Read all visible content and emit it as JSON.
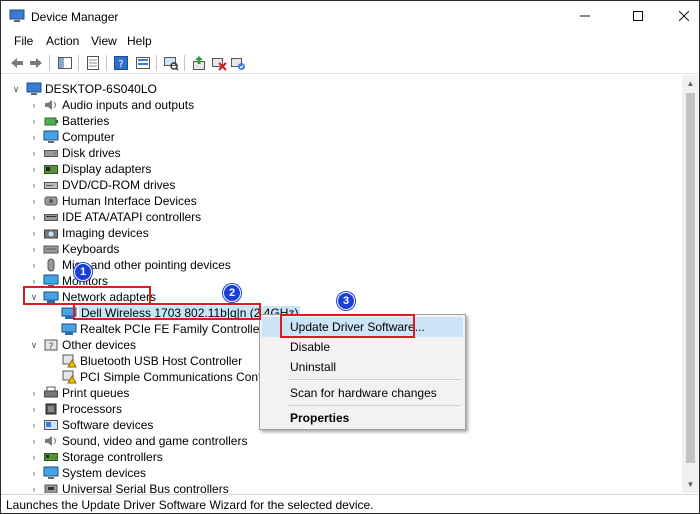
{
  "window": {
    "title": "Device Manager"
  },
  "menu": [
    "File",
    "Action",
    "View",
    "Help"
  ],
  "tree": {
    "root": "DESKTOP-6S040LO",
    "items": [
      "Audio inputs and outputs",
      "Batteries",
      "Computer",
      "Disk drives",
      "Display adapters",
      "DVD/CD-ROM drives",
      "Human Interface Devices",
      "IDE ATA/ATAPI controllers",
      "Imaging devices",
      "Keyboards",
      "Mice and other pointing devices",
      "Monitors",
      "Network adapters",
      "Dell Wireless 1703 802.11b|g|n (2.4GHz)",
      "Realtek PCIe FE Family Controller",
      "Other devices",
      "Bluetooth USB Host Controller",
      "PCI Simple Communications Controller",
      "Print queues",
      "Processors",
      "Software devices",
      "Sound, video and game controllers",
      "Storage controllers",
      "System devices",
      "Universal Serial Bus controllers"
    ]
  },
  "context_menu": {
    "update": "Update Driver Software...",
    "disable": "Disable",
    "uninstall": "Uninstall",
    "scan": "Scan for hardware changes",
    "properties": "Properties"
  },
  "badges": [
    "1",
    "2",
    "3"
  ],
  "status": "Launches the Update Driver Software Wizard for the selected device.",
  "colors": {
    "highlight": "#cce4f7",
    "annotation_red": "#d81e1e",
    "badge_blue": "#1a3fd6"
  }
}
